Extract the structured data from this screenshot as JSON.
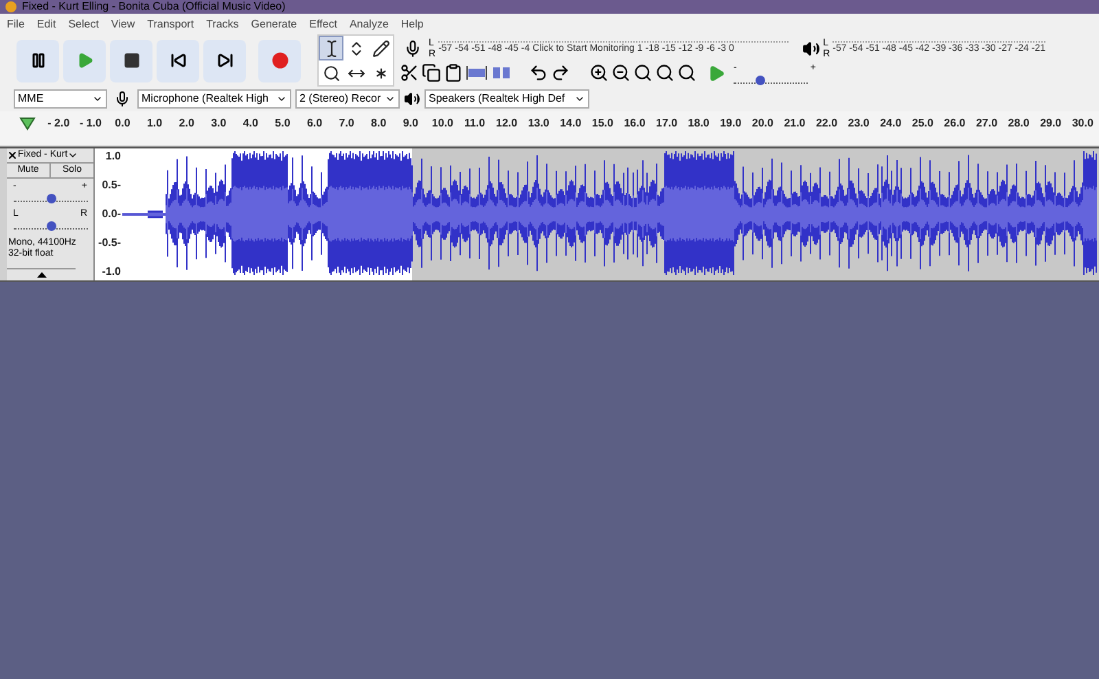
{
  "window": {
    "title": "Fixed - Kurt Elling - Bonita Cuba (Official Music Video)"
  },
  "menu": [
    "File",
    "Edit",
    "Select",
    "View",
    "Transport",
    "Tracks",
    "Generate",
    "Effect",
    "Analyze",
    "Help"
  ],
  "transport": [
    {
      "kind": "pause"
    },
    {
      "kind": "play"
    },
    {
      "kind": "stop"
    },
    {
      "kind": "start"
    },
    {
      "kind": "end"
    },
    {
      "kind": "record"
    }
  ],
  "tools": [
    {
      "kind": "select",
      "selected": true
    },
    {
      "kind": "envelope",
      "selected": false
    },
    {
      "kind": "draw",
      "selected": false
    },
    {
      "kind": "zoom",
      "selected": false
    },
    {
      "kind": "timeshift",
      "selected": false
    },
    {
      "kind": "multi",
      "selected": false
    }
  ],
  "record_meter": {
    "l": "L",
    "r": "R",
    "scale_left": "-57 -54 -51 -48 -45 -4",
    "prompt": "Click to Start Monitoring",
    "scale_right": "1 -18 -15 -12 -9 -6 -3 0"
  },
  "play_meter": {
    "l": "L",
    "r": "R",
    "scale": "-57 -54 -51 -48 -45 -42 -39 -36 -33 -30 -27 -24 -21"
  },
  "play_speed": {
    "minus": "-",
    "plus": "+",
    "level": 0.35
  },
  "devices": {
    "host": "MME",
    "microphone": "Microphone (Realtek High",
    "channels": "2 (Stereo) Recor",
    "speakers": "Speakers (Realtek High Def"
  },
  "ruler": [
    "- 2.0",
    "- 1.0",
    "0.0",
    "1.0",
    "2.0",
    "3.0",
    "4.0",
    "5.0",
    "6.0",
    "7.0",
    "8.0",
    "9.0",
    "10.0",
    "11.0",
    "12.0",
    "13.0",
    "14.0",
    "15.0",
    "16.0",
    "17.0",
    "18.0",
    "19.0",
    "20.0",
    "21.0",
    "22.0",
    "23.0",
    "24.0",
    "25.0",
    "26.0",
    "27.0",
    "28.0",
    "29.0",
    "30.0"
  ],
  "track": {
    "name": "Fixed - Kurt",
    "mute": "Mute",
    "solo": "Solo",
    "gain": {
      "minus": "-",
      "plus": "+",
      "level": 0.5
    },
    "pan": {
      "l": "L",
      "r": "R",
      "level": 0.5
    },
    "info": [
      "Mono, 44100Hz",
      "32-bit float"
    ],
    "yaxis": [
      "1.0",
      "0.5-",
      "0.0-",
      "-0.5-",
      "-1.0"
    ]
  }
}
